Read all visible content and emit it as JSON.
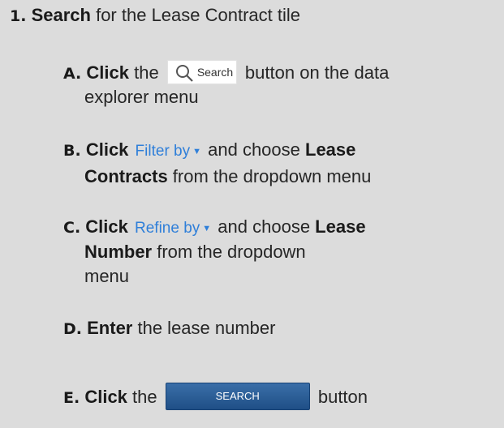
{
  "step1": {
    "num": "1.",
    "bold": "Search",
    "rest": " for the Lease Contract tile"
  },
  "stepA": {
    "letter": "A.",
    "bold": "Click",
    "pre": " the ",
    "button_label": "Search",
    "post": " button on the data",
    "line2": "explorer menu",
    "icon": "search-icon"
  },
  "stepB": {
    "letter": "B.",
    "bold": "Click",
    "control": "Filter by",
    "mid": " and choose ",
    "bold2": "Lease",
    "bold3": "Contracts",
    "rest": " from the dropdown menu"
  },
  "stepC": {
    "letter": "C.",
    "bold": "Click",
    "control": "Refine by",
    "mid": " and choose ",
    "bold2": "Lease",
    "bold3": "Number",
    "rest": " from the dropdown",
    "line3": "menu"
  },
  "stepD": {
    "letter": "D.",
    "bold": "Enter",
    "rest": " the lease number"
  },
  "stepE": {
    "letter": "E.",
    "bold": "Click",
    "pre": " the ",
    "button_label": "SEARCH",
    "post": " button"
  },
  "colors": {
    "link": "#2f7fd9",
    "button": "#2a5e98",
    "background": "#dcdcdc"
  }
}
